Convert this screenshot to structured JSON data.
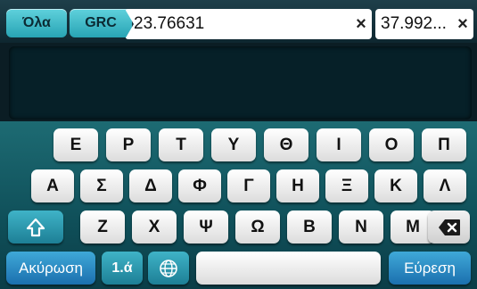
{
  "tabs": {
    "all": "Όλα",
    "grc": "GRC"
  },
  "search": {
    "longitude": "23.76631",
    "latitude": "37.992...",
    "clear_glyph": "×"
  },
  "keyboard": {
    "row1": [
      "Ε",
      "Ρ",
      "Τ",
      "Υ",
      "Θ",
      "Ι",
      "Ο",
      "Π"
    ],
    "row2": [
      "Α",
      "Σ",
      "Δ",
      "Φ",
      "Γ",
      "Η",
      "Ξ",
      "Κ",
      "Λ"
    ],
    "row3": [
      "Ζ",
      "Χ",
      "Ψ",
      "Ω",
      "Β",
      "Ν",
      "Μ"
    ],
    "cancel_label": "Ακύρωση",
    "numbers_label": "1.ά",
    "search_label": "Εύρεση",
    "icons": {
      "shift": "shift-icon",
      "backspace": "backspace-icon",
      "globe": "globe-icon"
    }
  },
  "colors": {
    "tab": "#28a4b4",
    "keyboard_bg": "#0f4f59",
    "action_key": "#1b6fae"
  }
}
